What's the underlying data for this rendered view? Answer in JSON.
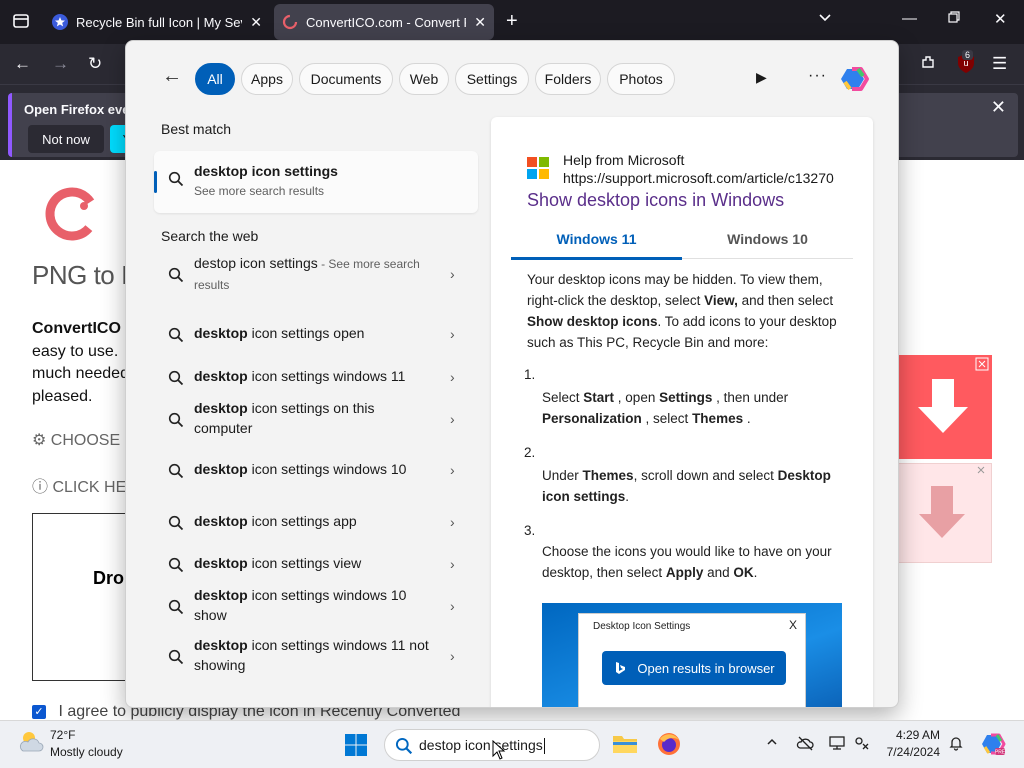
{
  "browser": {
    "tabs": [
      {
        "title": "Recycle Bin full Icon | My Sever"
      },
      {
        "title": "ConvertICO.com - Convert PNG"
      }
    ],
    "extension_badge": "6"
  },
  "notification": {
    "text": "Open Firefox every",
    "not_now_label": "Not now",
    "yes_label": "Ye"
  },
  "page": {
    "title": "PNG to IC",
    "para_lead": "ConvertICO",
    "para_rest": "easy to use. much needed pleased.",
    "choose_label": "CHOOSE",
    "click_label": "CLICK HE",
    "drop_label": "Dro",
    "agree_label": "I agree to publicly display the icon in Recently Converted"
  },
  "search_panel": {
    "filters": [
      "All",
      "Apps",
      "Documents",
      "Web",
      "Settings",
      "Folders",
      "Photos"
    ],
    "best_match_label": "Best match",
    "best_match": {
      "title": "desktop icon settings",
      "subtitle": "See more search results"
    },
    "web_label": "Search the web",
    "web_results": [
      {
        "pre": "destop icon settings",
        "bold": "",
        "see": " - See more search results"
      },
      {
        "pre": "desktop",
        "bold": " icon settings open",
        "see": ""
      },
      {
        "pre": "desktop",
        "bold": " icon settings windows 11",
        "see": ""
      },
      {
        "pre": "desktop",
        "bold": " icon settings on this computer",
        "see": ""
      },
      {
        "pre": "desktop",
        "bold": " icon settings windows 10",
        "see": ""
      },
      {
        "pre": "desktop",
        "bold": " icon settings app",
        "see": ""
      },
      {
        "pre": "desktop",
        "bold": " icon settings view",
        "see": ""
      },
      {
        "pre": "desktop",
        "bold": " icon settings windows 10 show",
        "see": ""
      },
      {
        "pre": "desktop",
        "bold": " icon settings windows 11 not showing",
        "see": ""
      }
    ],
    "preview": {
      "help_from": "Help from Microsoft",
      "url": "https://support.microsoft.com/article/c13270",
      "title": "Show desktop icons in Windows",
      "tab_active": "Windows 11",
      "tab_other": "Windows 10",
      "intro_1": "Your desktop icons may be hidden. To view them, right-click the desktop, select ",
      "intro_view": "View,",
      "intro_2": " and then select ",
      "intro_show": "Show desktop icons",
      "intro_3": ". To add icons to your desktop such as This PC, Recycle Bin and more:",
      "step1_num": "1.",
      "step1": [
        "Select ",
        "Start",
        " , open ",
        "Settings",
        " , then under ",
        "Personalization",
        " , select ",
        "Themes",
        " ."
      ],
      "step2_num": "2.",
      "step2": [
        "Under ",
        "Themes",
        ", scroll down and select ",
        "Desktop icon settings",
        "."
      ],
      "step3_num": "3.",
      "step3": [
        "Choose the icons you would like to have on your desktop, then select ",
        "Apply",
        " and ",
        "OK",
        "."
      ],
      "shot_dialog_title": "Desktop Icon Settings",
      "open_button": "Open results in browser"
    }
  },
  "taskbar": {
    "temp": "72°F",
    "condition": "Mostly cloudy",
    "search_query": "destop icon settings",
    "time": "4:29 AM",
    "date": "7/24/2024"
  }
}
